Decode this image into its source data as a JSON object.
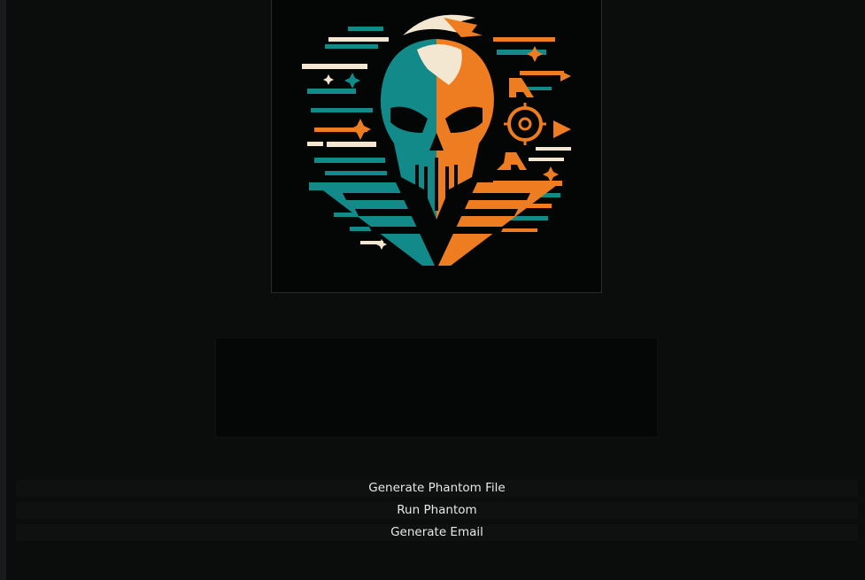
{
  "logo": {
    "icon": "skull-emblem-icon",
    "colors": {
      "teal": "#138a8a",
      "orange": "#ee7d22",
      "cream": "#f4e7d2",
      "background": "#040606"
    }
  },
  "output_box": {
    "text": ""
  },
  "actions": {
    "generate_file": "Generate Phantom File",
    "run": "Run Phantom",
    "email": "Generate Email"
  }
}
